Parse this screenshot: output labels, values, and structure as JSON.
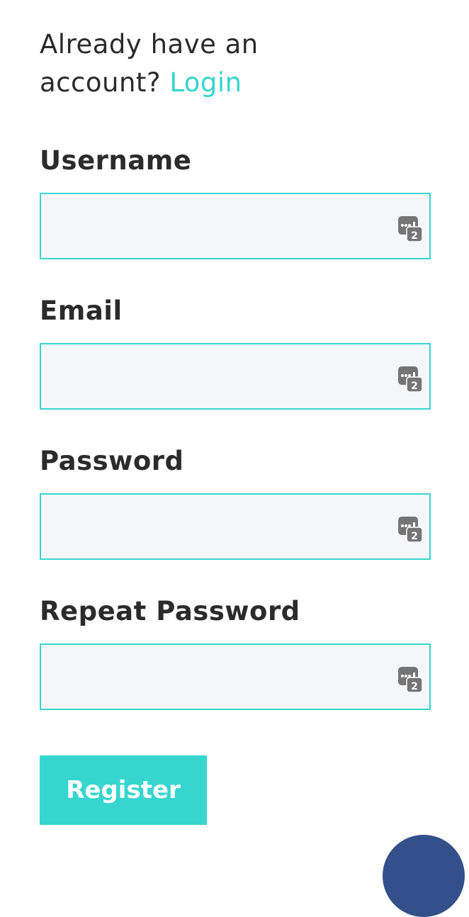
{
  "login_prompt": {
    "text": "Already have an account?",
    "link_label": "Login"
  },
  "fields": [
    {
      "label": "Username",
      "value": "",
      "icon": "password-manager-icon",
      "icon_badge": "2"
    },
    {
      "label": "Email",
      "value": "",
      "icon": "password-manager-icon",
      "icon_badge": "2"
    },
    {
      "label": "Password",
      "value": "",
      "icon": "password-manager-icon",
      "icon_badge": "2"
    },
    {
      "label": "Repeat Password",
      "value": "",
      "icon": "password-manager-icon",
      "icon_badge": "2"
    }
  ],
  "register_button": {
    "label": "Register"
  },
  "colors": {
    "accent": "#36d6cf",
    "text": "#2b2b2b",
    "input_background": "#f5f6f8",
    "chat_bubble": "#33508a"
  }
}
